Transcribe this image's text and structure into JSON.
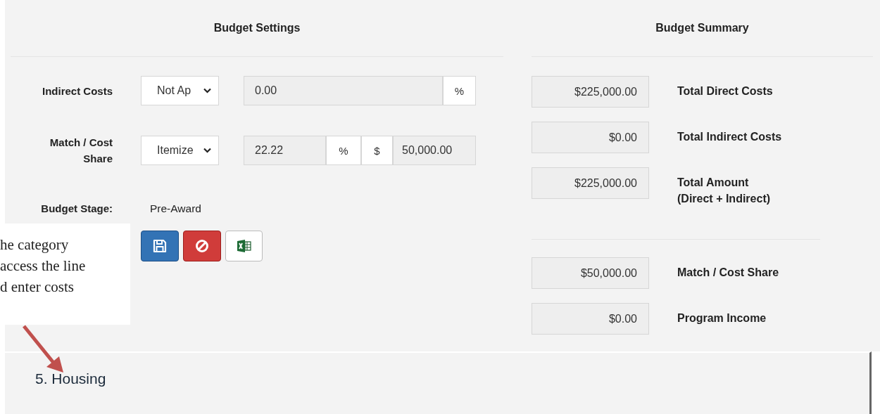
{
  "budget_settings": {
    "title": "Budget Settings",
    "indirect_costs": {
      "label": "Indirect Costs",
      "type_select": "Not Ap",
      "rate": "0.00",
      "rate_unit": "%"
    },
    "match": {
      "label": "Match / Cost Share",
      "type_select": "Itemize",
      "rate": "22.22",
      "rate_unit": "%",
      "amount_unit": "$",
      "amount": "50,000.00"
    },
    "stage": {
      "label": "Budget Stage:",
      "value": "Pre-Award"
    },
    "buttons": [
      {
        "kind": "save"
      },
      {
        "kind": "cancel"
      },
      {
        "kind": "excel"
      }
    ]
  },
  "budget_summary": {
    "title": "Budget Summary",
    "totals": [
      {
        "value": "$225,000.00",
        "label": "Total Direct Costs"
      },
      {
        "value": "$0.00",
        "label": "Total Indirect Costs"
      },
      {
        "value": "$225,000.00",
        "label": "Total Amount (Direct + Indirect)"
      }
    ],
    "other": [
      {
        "value": "$50,000.00",
        "label": "Match / Cost Share"
      },
      {
        "value": "$0.00",
        "label": "Program Income"
      }
    ]
  },
  "callout": {
    "lines": [
      "he category",
      "access the line",
      "d enter costs"
    ]
  },
  "category": {
    "label": "5. Housing"
  }
}
